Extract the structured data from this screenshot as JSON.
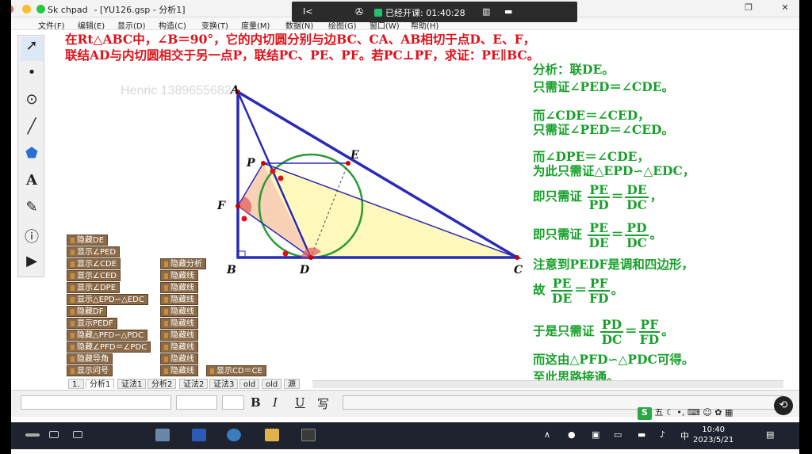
{
  "window": {
    "app_name": "Sk  chpad",
    "file_title": "- [YU126.gsp - 分析1]"
  },
  "menu": [
    "文件(F)",
    "编辑(E)",
    "显示(D)",
    "构造(C)",
    "变换(T)",
    "度量(M)",
    "数据(N)",
    "绘图(G)",
    "窗口(W)",
    "帮助(H)"
  ],
  "meeting": {
    "back": "I<",
    "status": "已经开课: 01:40:28"
  },
  "problem_text": [
    "在Rt△ABC中，∠B＝90°，它的内切圆分别与边BC、CA、AB相切于点D、E、F，",
    "联结AD与内切圆相交于另一点P，联结PC、PE、PF。若PC⊥PF，求证：PE∥BC。"
  ],
  "watermark": "Henric 13896556824",
  "points": {
    "A": "A",
    "B": "B",
    "C": "C",
    "D": "D",
    "E": "E",
    "F": "F",
    "P": "P"
  },
  "analysis": {
    "l1": "分析：联DE。",
    "l2": "只需证∠PED＝∠CDE。",
    "l3": "而∠CDE＝∠CED，",
    "l4": "只需证∠PED＝∠CED。",
    "l5": "而∠DPE＝∠CDE，",
    "l6": "为此只需证△EPD∽△EDC，",
    "l7_pre": "即只需证",
    "l7_f1n": "PE",
    "l7_f1d": "PD",
    "l7_eq": "＝",
    "l7_f2n": "DE",
    "l7_f2d": "DC",
    "l7_post": "，",
    "l8_pre": "即只需证",
    "l8_f1n": "PE",
    "l8_f1d": "DE",
    "l8_eq": "＝",
    "l8_f2n": "PD",
    "l8_f2d": "DC",
    "l8_post": "。",
    "l9": "注意到PEDF是调和四边形，",
    "l10_pre": "故",
    "l10_f1n": "PE",
    "l10_f1d": "DE",
    "l10_eq": "＝",
    "l10_f2n": "PF",
    "l10_f2d": "FD",
    "l10_post": "。",
    "l11_pre": "于是只需证",
    "l11_f1n": "PD",
    "l11_f1d": "DC",
    "l11_eq": "＝",
    "l11_f2n": "PF",
    "l11_f2d": "FD",
    "l11_post": "。",
    "l12": "而这由△PFD∽△PDC可得。",
    "l13": "至此思路接通。"
  },
  "buttons_left": [
    "隐藏DE",
    "显示∠PED",
    "显示∠CDE",
    "显示∠CED",
    "显示∠DPE",
    "显示△EPD∽△EDC",
    "隐藏DF",
    "显示PEDF",
    "隐藏△PFD∽△PDC",
    "隐藏∠PFD＝∠PDC",
    "隐藏导角",
    "显示问号"
  ],
  "buttons_mid": [
    "隐藏分析",
    "隐藏线",
    "隐藏线",
    "隐藏线",
    "隐藏线",
    "隐藏线",
    "隐藏线",
    "隐藏线",
    "隐藏线",
    "隐藏线"
  ],
  "button_cd_ce": "显示CD＝CE",
  "tabs": [
    "1.",
    "分析1",
    "证法1",
    "分析2",
    "证法2",
    "证法3",
    "old",
    "old",
    "源"
  ],
  "format": {
    "bold": "B",
    "italic": "I",
    "underline": "U",
    "special": "写"
  },
  "tray": {
    "lang": "中",
    "time": "10:40",
    "date": "2023/5/21",
    "sogou": "五"
  },
  "colors": {
    "triangle": "#2a2ab8",
    "circle": "#2a9a34",
    "problem": "#e0101a",
    "analysis": "#17a02a"
  }
}
